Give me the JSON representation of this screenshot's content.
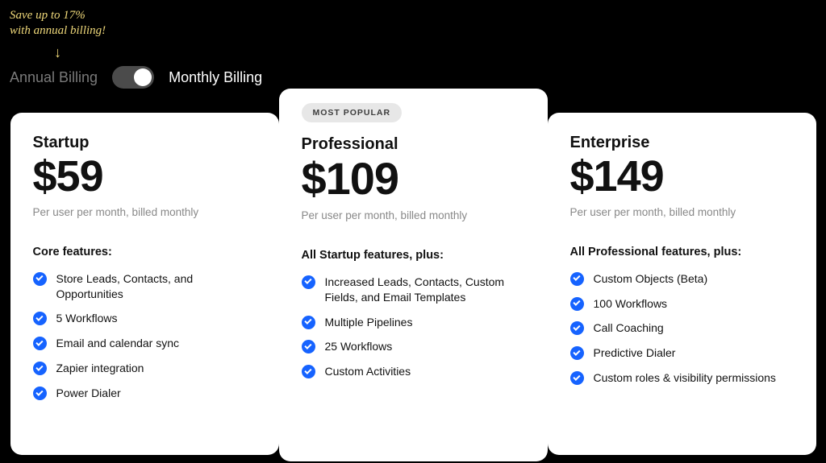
{
  "promo": {
    "line1": "Save up to 17%",
    "line2": "with annual billing!"
  },
  "billing": {
    "annual_label": "Annual Billing",
    "monthly_label": "Monthly Billing"
  },
  "plans": {
    "startup": {
      "name": "Startup",
      "price": "$59",
      "subtext": "Per user per month, billed monthly",
      "features_heading": "Core features:",
      "features": [
        "Store Leads, Contacts, and Opportunities",
        "5 Workflows",
        "Email and calendar sync",
        "Zapier integration",
        "Power Dialer"
      ]
    },
    "professional": {
      "badge": "MOST POPULAR",
      "name": "Professional",
      "price": "$109",
      "subtext": "Per user per month, billed monthly",
      "features_heading": "All Startup features, plus:",
      "features": [
        "Increased Leads, Contacts, Custom Fields, and Email Templates",
        "Multiple Pipelines",
        "25 Workflows",
        "Custom Activities"
      ]
    },
    "enterprise": {
      "name": "Enterprise",
      "price": "$149",
      "subtext": "Per user per month, billed monthly",
      "features_heading": "All Professional features, plus:",
      "features": [
        "Custom Objects (Beta)",
        "100 Workflows",
        "Call Coaching",
        "Predictive Dialer",
        "Custom roles & visibility permissions"
      ]
    }
  }
}
